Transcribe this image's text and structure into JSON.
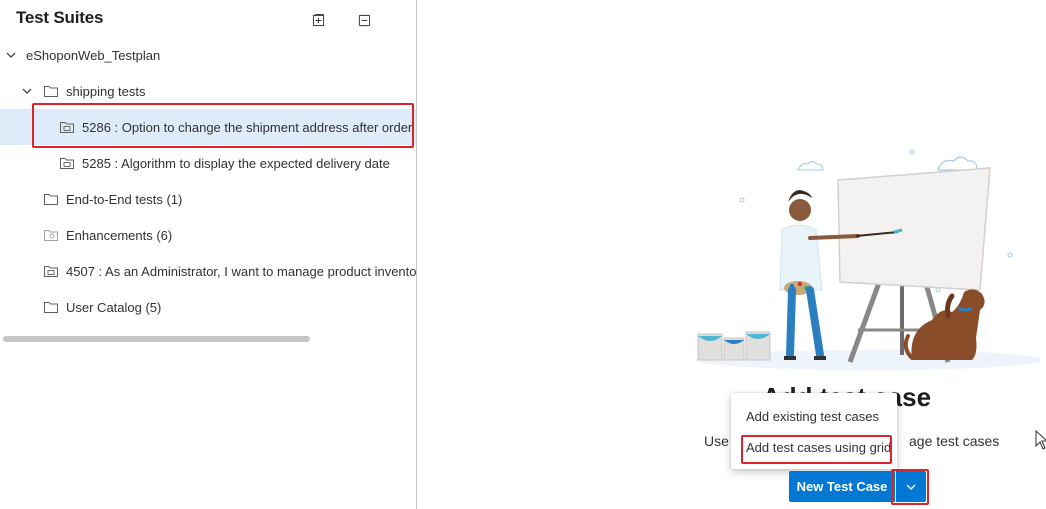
{
  "panel": {
    "title": "Test Suites",
    "expand_icon": "expand-all-icon",
    "collapse_icon": "collapse-all-icon"
  },
  "tree": {
    "root": "eShoponWeb_Testplan",
    "items": [
      {
        "label": "shipping tests",
        "icon": "folder-icon",
        "expanded": true
      },
      {
        "label": "5286 : Option to change the shipment address after order",
        "icon": "requirement-suite-icon",
        "selected": true
      },
      {
        "label": "5285 : Algorithm to display the expected delivery date",
        "icon": "requirement-suite-icon"
      },
      {
        "label": "End-to-End tests (1)",
        "icon": "folder-icon"
      },
      {
        "label": "Enhancements (6)",
        "icon": "query-suite-icon"
      },
      {
        "label": "4507 : As an Administrator, I want to manage product invento",
        "icon": "requirement-suite-icon"
      },
      {
        "label": "User Catalog (5)",
        "icon": "folder-icon"
      }
    ]
  },
  "empty_state": {
    "title": "Add test case",
    "description": "Use the button below to add and manage test cases",
    "title_visible": "Add test case",
    "desc_visible_left": "Use",
    "desc_visible_right": "age test cases"
  },
  "menu": {
    "items": [
      {
        "label": "Add existing test cases"
      },
      {
        "label": "Add test cases using grid"
      }
    ]
  },
  "actions": {
    "new_test_case": "New Test Case",
    "dropdown_icon": "chevron-down-icon"
  },
  "colors": {
    "accent": "#0078d4",
    "selected_row": "#deecf9",
    "highlight": "#d9252b"
  }
}
